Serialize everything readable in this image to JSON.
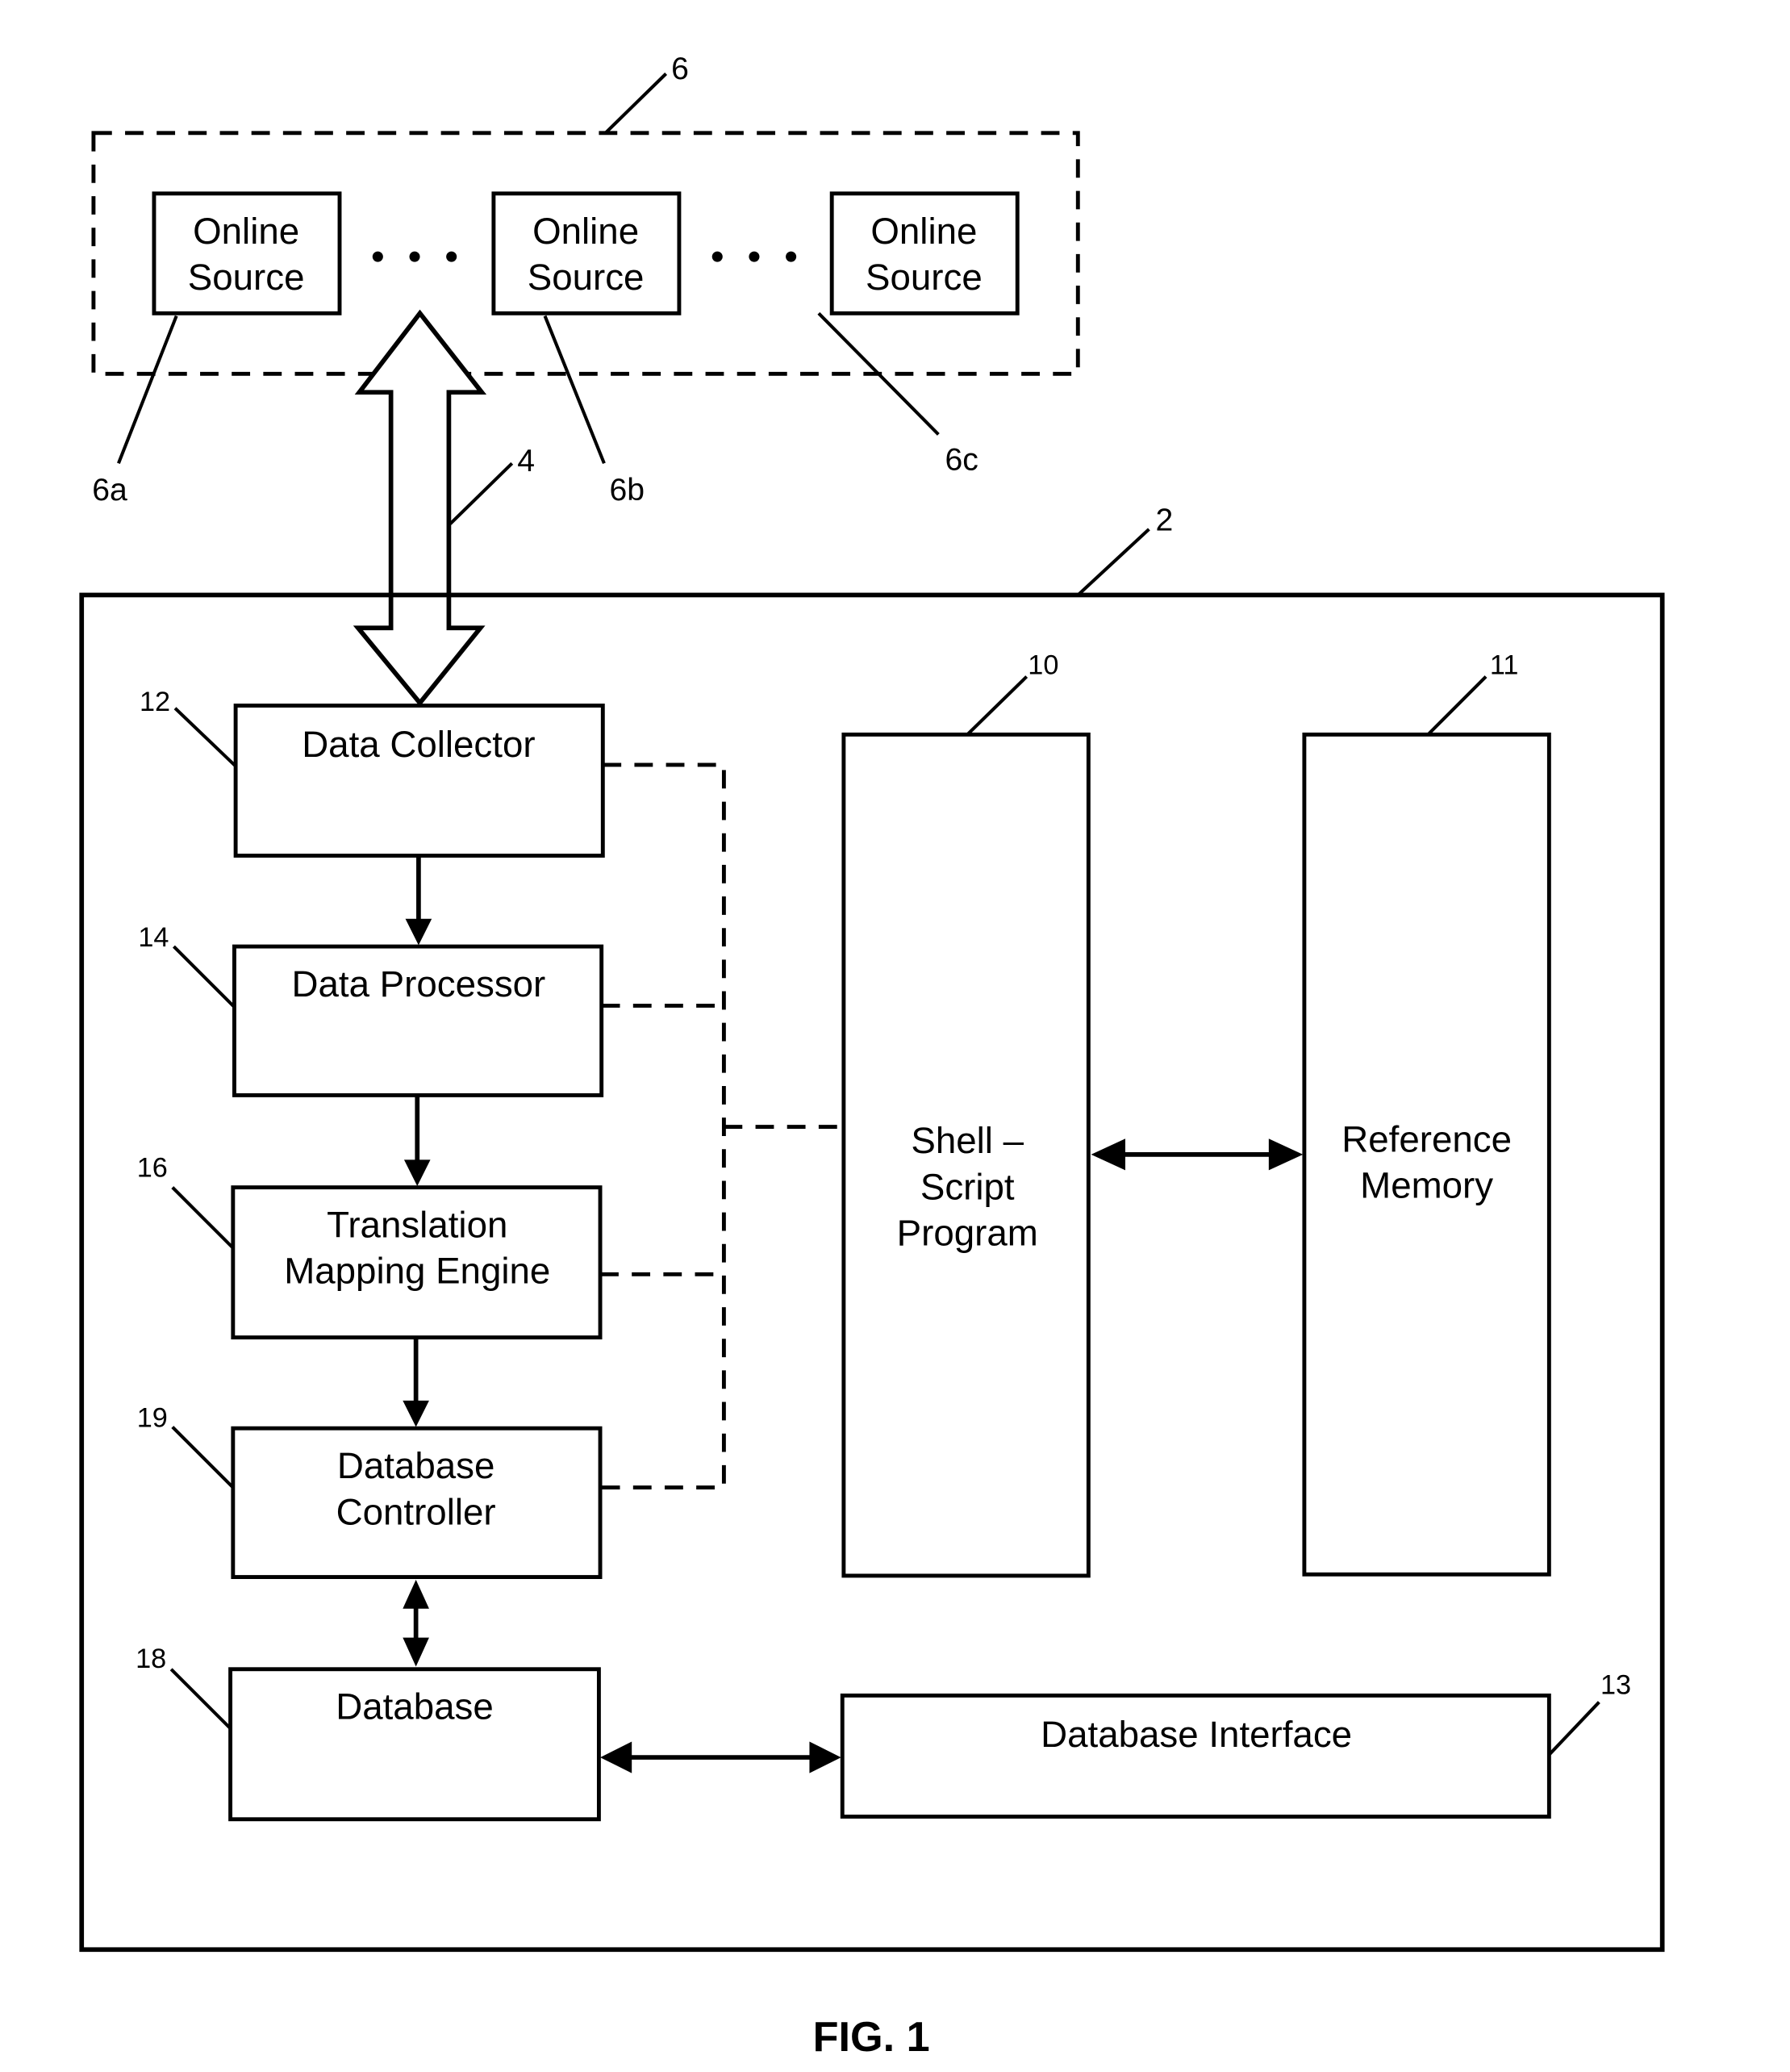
{
  "figure": {
    "caption": "FIG. 1",
    "ref_numbers": {
      "online_sources_group": "6",
      "online_source_a": "6a",
      "online_source_b": "6b",
      "online_source_c": "6c",
      "network_link": "4",
      "system": "2",
      "shell_script_program": "10",
      "reference_memory": "11",
      "data_collector": "12",
      "database_interface": "13",
      "data_processor": "14",
      "translation_mapping_engine": "16",
      "database": "18",
      "database_controller": "19"
    },
    "online_sources": [
      {
        "line1": "Online",
        "line2": "Source"
      },
      {
        "line1": "Online",
        "line2": "Source"
      },
      {
        "line1": "Online",
        "line2": "Source"
      }
    ],
    "ellipsis": "• • •",
    "blocks": {
      "data_collector": "Data Collector",
      "data_processor": "Data Processor",
      "translation_mapping_engine": {
        "line1": "Translation",
        "line2": "Mapping Engine"
      },
      "database_controller": {
        "line1": "Database",
        "line2": "Controller"
      },
      "database": "Database",
      "shell_script_program": {
        "line1": "Shell –",
        "line2": "Script",
        "line3": "Program"
      },
      "reference_memory": {
        "line1": "Reference",
        "line2": "Memory"
      },
      "database_interface": "Database Interface"
    }
  }
}
